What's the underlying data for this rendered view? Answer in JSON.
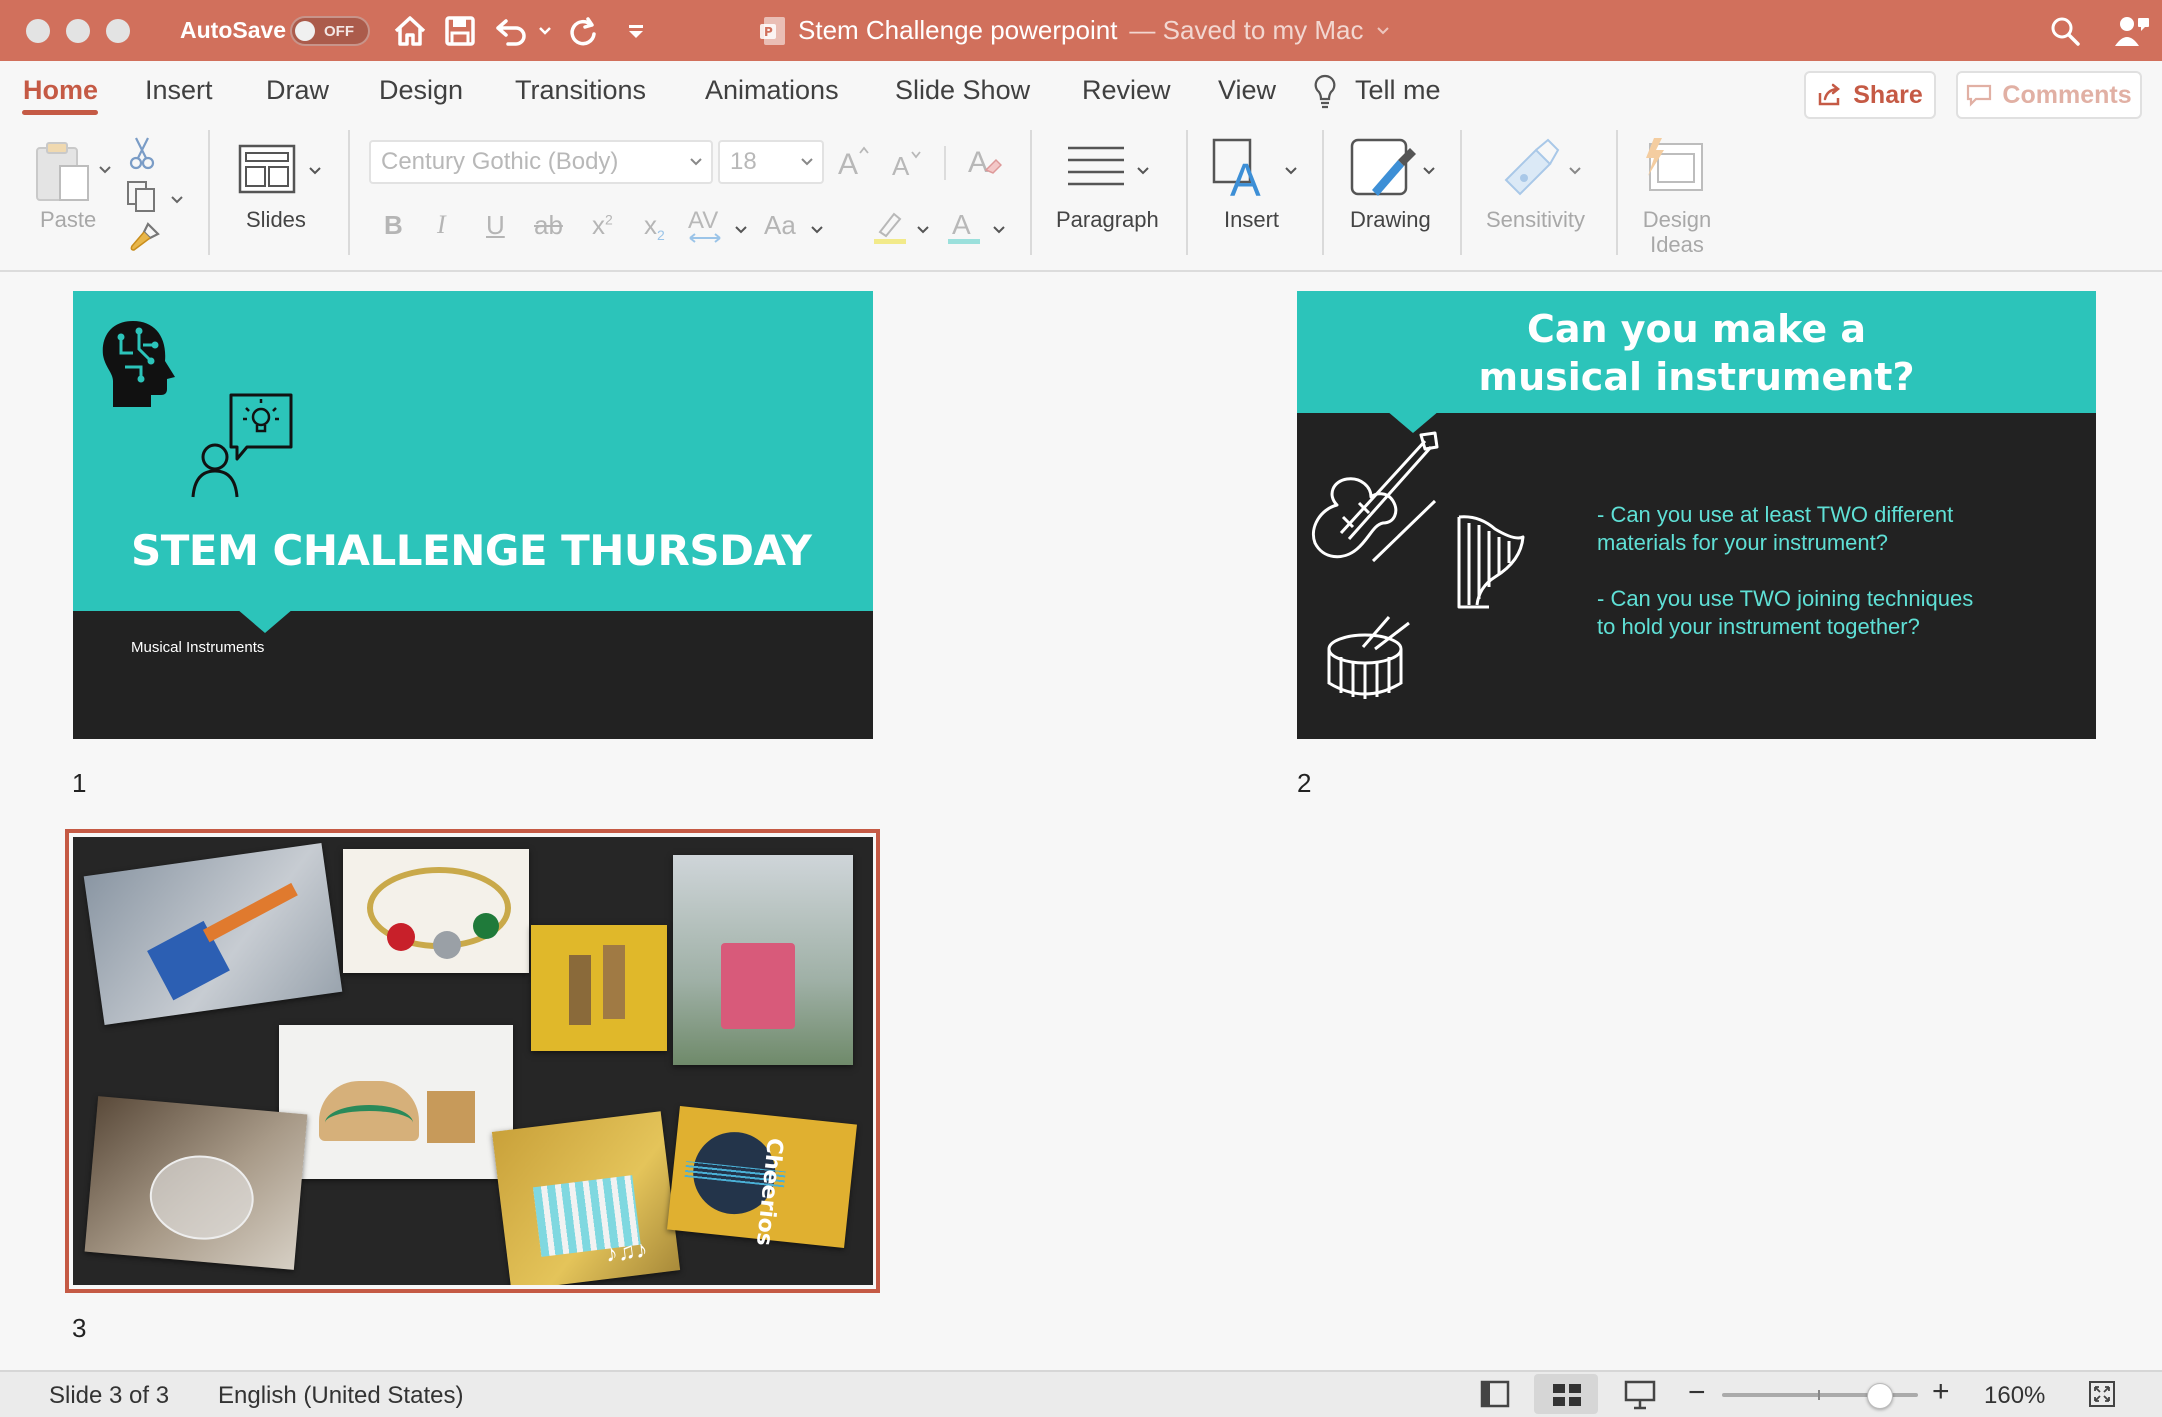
{
  "window": {
    "autosave_label": "AutoSave",
    "autosave_state": "OFF",
    "doc_title": "Stem Challenge powerpoint",
    "save_status": "— Saved to my Mac"
  },
  "tabs": [
    "Home",
    "Insert",
    "Draw",
    "Design",
    "Transitions",
    "Animations",
    "Slide Show",
    "Review",
    "View"
  ],
  "tell_me": "Tell me",
  "share_label": "Share",
  "comments_label": "Comments",
  "ribbon": {
    "paste": "Paste",
    "slides": "Slides",
    "font_name": "Century Gothic (Body)",
    "font_size": "18",
    "paragraph": "Paragraph",
    "insert": "Insert",
    "drawing": "Drawing",
    "sensitivity": "Sensitivity",
    "design_ideas_1": "Design",
    "design_ideas_2": "Ideas",
    "char_spacing": "AV",
    "change_case": "Aa"
  },
  "slides": [
    {
      "number": "1",
      "title": "STEM CHALLENGE THURSDAY",
      "subtitle": "Musical Instruments"
    },
    {
      "number": "2",
      "title_line1": "Can you make a",
      "title_line2": "musical instrument?",
      "bullet1_line1": "- Can you use at least TWO different",
      "bullet1_line2": "materials for your instrument?",
      "bullet2_line1": "- Can you use TWO joining techniques",
      "bullet2_line2": "to hold your instrument together?"
    },
    {
      "number": "3",
      "photo_text_cheerios": "Cheerios"
    }
  ],
  "status": {
    "slide_info": "Slide 3 of 3",
    "language": "English (United States)",
    "zoom": "160%",
    "zoom_fraction": 0.8
  },
  "colors": {
    "titlebar": "#d1705c",
    "accent": "#c55a45",
    "teal": "#2cc4ba",
    "slide_dark": "#222222"
  }
}
